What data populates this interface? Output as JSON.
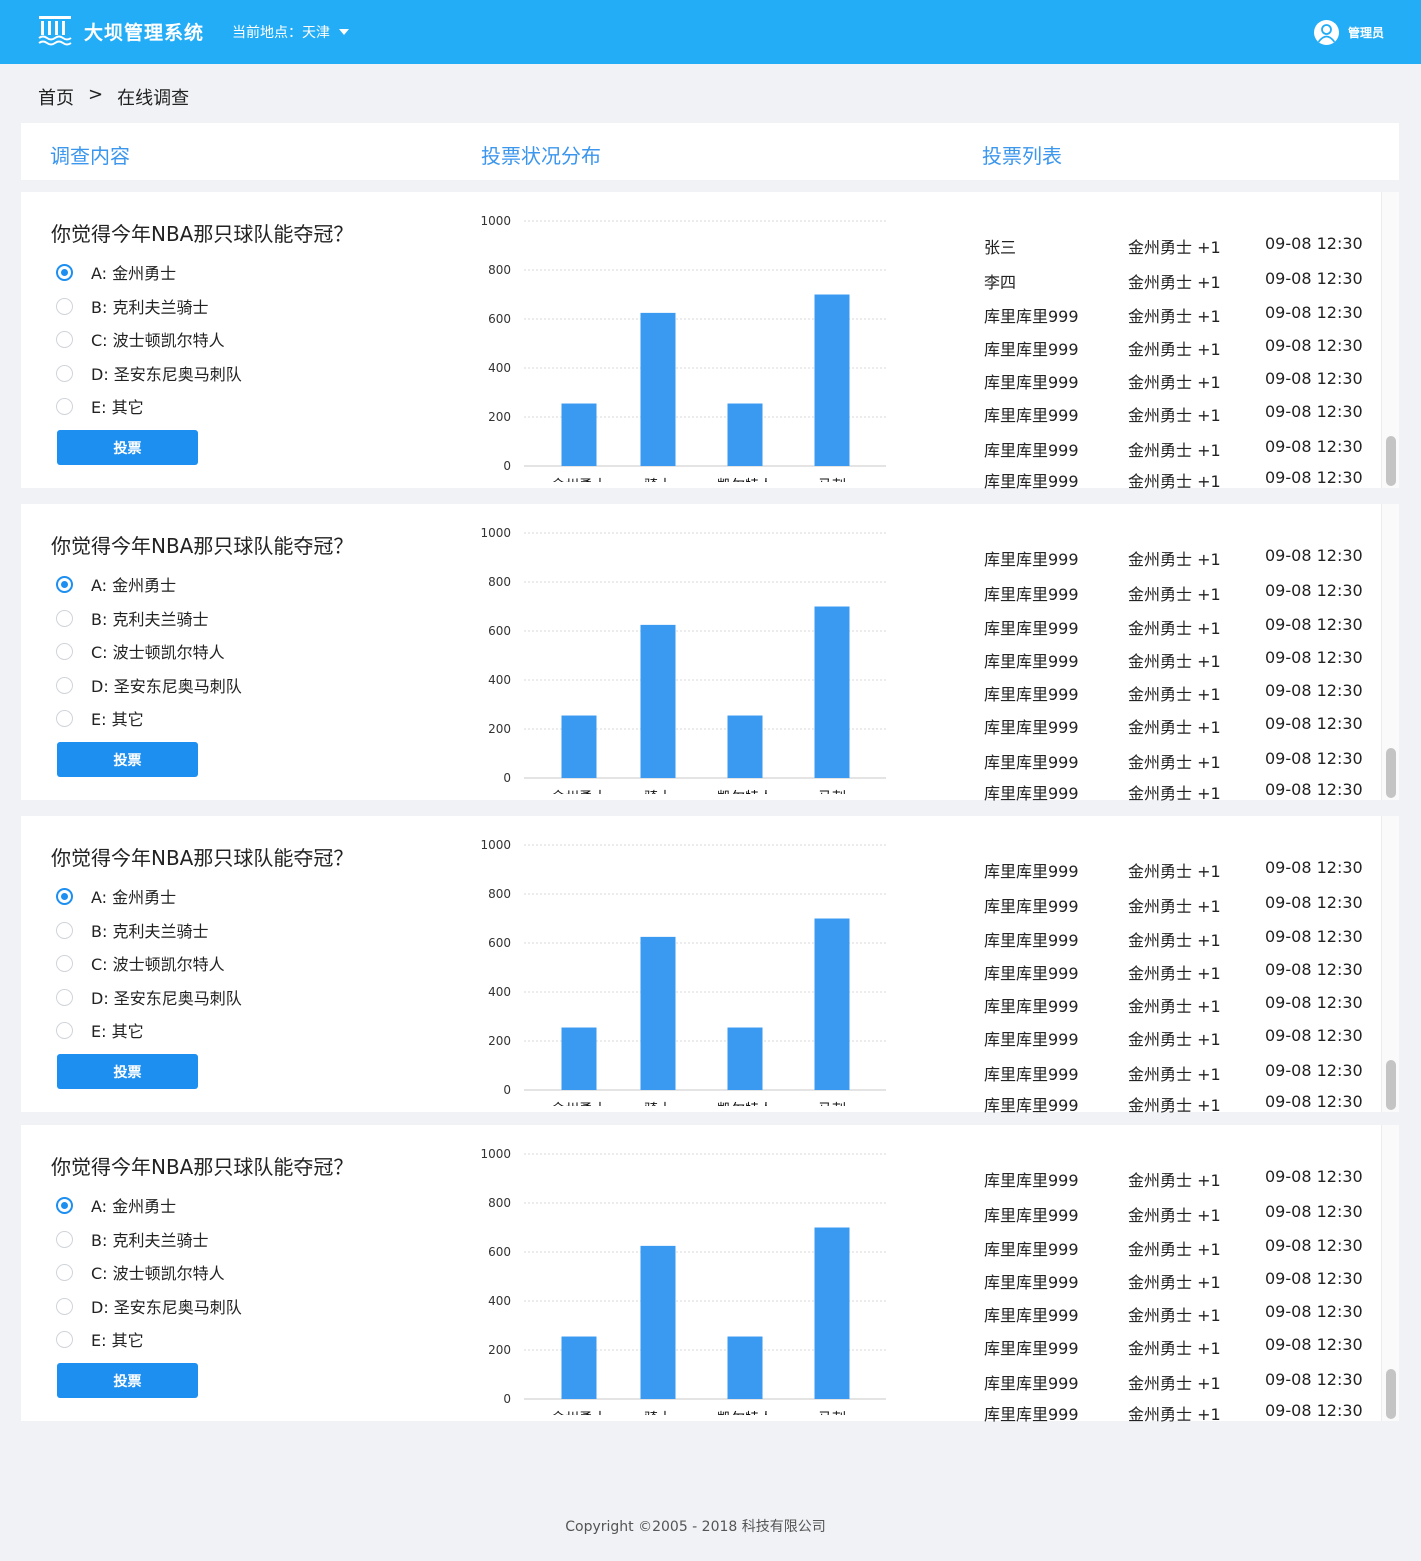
{
  "header": {
    "app_title": "大坝管理系统",
    "location_label": "当前地点：天津",
    "user_name": "管理员",
    "logo_icon": "dam-logo-icon",
    "dropdown_icon": "caret-down-icon",
    "avatar_icon": "user-avatar-icon"
  },
  "breadcrumb": {
    "home": "首页",
    "separator": ">",
    "current": "在线调查"
  },
  "columns": {
    "content": "调查内容",
    "distribution": "投票状况分布",
    "list": "投票列表"
  },
  "colors": {
    "header_bg": "#24adf7",
    "accent": "#1d8ff0",
    "column_title": "#3b96ed",
    "bar": "#3a9af2",
    "page_bg": "#f0f2f5"
  },
  "surveys": [
    {
      "question": "你觉得今年NBA那只球队能夺冠？",
      "options": [
        {
          "label": "A: 金州勇士",
          "selected": true
        },
        {
          "label": "B: 克利夫兰骑士",
          "selected": false
        },
        {
          "label": "C: 波士顿凯尔特人",
          "selected": false
        },
        {
          "label": "D: 圣安东尼奥马刺队",
          "selected": false
        },
        {
          "label": "E: 其它",
          "selected": false
        }
      ],
      "vote_button": "投票",
      "chart_data": {
        "type": "bar",
        "categories": [
          "金州勇士",
          "骑士",
          "凯尔特人",
          "马刺"
        ],
        "values": [
          255,
          625,
          255,
          700
        ],
        "ylim": [
          0,
          1000
        ],
        "yticks": [
          0,
          200,
          400,
          600,
          800,
          1000
        ],
        "grid": true
      },
      "votes": [
        {
          "name": "张三",
          "team": "金州勇士 +1",
          "time": "09-08 12:30"
        },
        {
          "name": "李四",
          "team": "金州勇士 +1",
          "time": "09-08 12:30"
        },
        {
          "name": "库里库里999",
          "team": "金州勇士 +1",
          "time": "09-08 12:30"
        },
        {
          "name": "库里库里999",
          "team": "金州勇士 +1",
          "time": "09-08 12:30"
        },
        {
          "name": "库里库里999",
          "team": "金州勇士 +1",
          "time": "09-08 12:30"
        },
        {
          "name": "库里库里999",
          "team": "金州勇士 +1",
          "time": "09-08 12:30"
        },
        {
          "name": "库里库里999",
          "team": "金州勇士 +1",
          "time": "09-08 12:30"
        },
        {
          "name": "库里库里999",
          "team": "金州勇士 +1",
          "time": "09-08 12:30"
        }
      ]
    },
    {
      "question": "你觉得今年NBA那只球队能夺冠？",
      "options": [
        {
          "label": "A: 金州勇士",
          "selected": true
        },
        {
          "label": "B: 克利夫兰骑士",
          "selected": false
        },
        {
          "label": "C: 波士顿凯尔特人",
          "selected": false
        },
        {
          "label": "D: 圣安东尼奥马刺队",
          "selected": false
        },
        {
          "label": "E: 其它",
          "selected": false
        }
      ],
      "vote_button": "投票",
      "chart_data": {
        "type": "bar",
        "categories": [
          "金州勇士",
          "骑士",
          "凯尔特人",
          "马刺"
        ],
        "values": [
          255,
          625,
          255,
          700
        ],
        "ylim": [
          0,
          1000
        ],
        "yticks": [
          0,
          200,
          400,
          600,
          800,
          1000
        ],
        "grid": true
      },
      "votes": [
        {
          "name": "库里库里999",
          "team": "金州勇士 +1",
          "time": "09-08 12:30"
        },
        {
          "name": "库里库里999",
          "team": "金州勇士 +1",
          "time": "09-08 12:30"
        },
        {
          "name": "库里库里999",
          "team": "金州勇士 +1",
          "time": "09-08 12:30"
        },
        {
          "name": "库里库里999",
          "team": "金州勇士 +1",
          "time": "09-08 12:30"
        },
        {
          "name": "库里库里999",
          "team": "金州勇士 +1",
          "time": "09-08 12:30"
        },
        {
          "name": "库里库里999",
          "team": "金州勇士 +1",
          "time": "09-08 12:30"
        },
        {
          "name": "库里库里999",
          "team": "金州勇士 +1",
          "time": "09-08 12:30"
        },
        {
          "name": "库里库里999",
          "team": "金州勇士 +1",
          "time": "09-08 12:30"
        }
      ]
    },
    {
      "question": "你觉得今年NBA那只球队能夺冠？",
      "options": [
        {
          "label": "A: 金州勇士",
          "selected": true
        },
        {
          "label": "B: 克利夫兰骑士",
          "selected": false
        },
        {
          "label": "C: 波士顿凯尔特人",
          "selected": false
        },
        {
          "label": "D: 圣安东尼奥马刺队",
          "selected": false
        },
        {
          "label": "E: 其它",
          "selected": false
        }
      ],
      "vote_button": "投票",
      "chart_data": {
        "type": "bar",
        "categories": [
          "金州勇士",
          "骑士",
          "凯尔特人",
          "马刺"
        ],
        "values": [
          255,
          625,
          255,
          700
        ],
        "ylim": [
          0,
          1000
        ],
        "yticks": [
          0,
          200,
          400,
          600,
          800,
          1000
        ],
        "grid": true
      },
      "votes": [
        {
          "name": "库里库里999",
          "team": "金州勇士 +1",
          "time": "09-08 12:30"
        },
        {
          "name": "库里库里999",
          "team": "金州勇士 +1",
          "time": "09-08 12:30"
        },
        {
          "name": "库里库里999",
          "team": "金州勇士 +1",
          "time": "09-08 12:30"
        },
        {
          "name": "库里库里999",
          "team": "金州勇士 +1",
          "time": "09-08 12:30"
        },
        {
          "name": "库里库里999",
          "team": "金州勇士 +1",
          "time": "09-08 12:30"
        },
        {
          "name": "库里库里999",
          "team": "金州勇士 +1",
          "time": "09-08 12:30"
        },
        {
          "name": "库里库里999",
          "team": "金州勇士 +1",
          "time": "09-08 12:30"
        },
        {
          "name": "库里库里999",
          "team": "金州勇士 +1",
          "time": "09-08 12:30"
        }
      ]
    },
    {
      "question": "你觉得今年NBA那只球队能夺冠？",
      "options": [
        {
          "label": "A: 金州勇士",
          "selected": true
        },
        {
          "label": "B: 克利夫兰骑士",
          "selected": false
        },
        {
          "label": "C: 波士顿凯尔特人",
          "selected": false
        },
        {
          "label": "D: 圣安东尼奥马刺队",
          "selected": false
        },
        {
          "label": "E: 其它",
          "selected": false
        }
      ],
      "vote_button": "投票",
      "chart_data": {
        "type": "bar",
        "categories": [
          "金州勇士",
          "骑士",
          "凯尔特人",
          "马刺"
        ],
        "values": [
          255,
          625,
          255,
          700
        ],
        "ylim": [
          0,
          1000
        ],
        "yticks": [
          0,
          200,
          400,
          600,
          800,
          1000
        ],
        "grid": true
      },
      "votes": [
        {
          "name": "库里库里999",
          "team": "金州勇士 +1",
          "time": "09-08 12:30"
        },
        {
          "name": "库里库里999",
          "team": "金州勇士 +1",
          "time": "09-08 12:30"
        },
        {
          "name": "库里库里999",
          "team": "金州勇士 +1",
          "time": "09-08 12:30"
        },
        {
          "name": "库里库里999",
          "team": "金州勇士 +1",
          "time": "09-08 12:30"
        },
        {
          "name": "库里库里999",
          "team": "金州勇士 +1",
          "time": "09-08 12:30"
        },
        {
          "name": "库里库里999",
          "team": "金州勇士 +1",
          "time": "09-08 12:30"
        },
        {
          "name": "库里库里999",
          "team": "金州勇士 +1",
          "time": "09-08 12:30"
        },
        {
          "name": "库里库里999",
          "team": "金州勇士 +1",
          "time": "09-08 12:30"
        }
      ]
    }
  ],
  "footer": {
    "copyright": "Copyright ©2005 - 2018  科技有限公司"
  }
}
